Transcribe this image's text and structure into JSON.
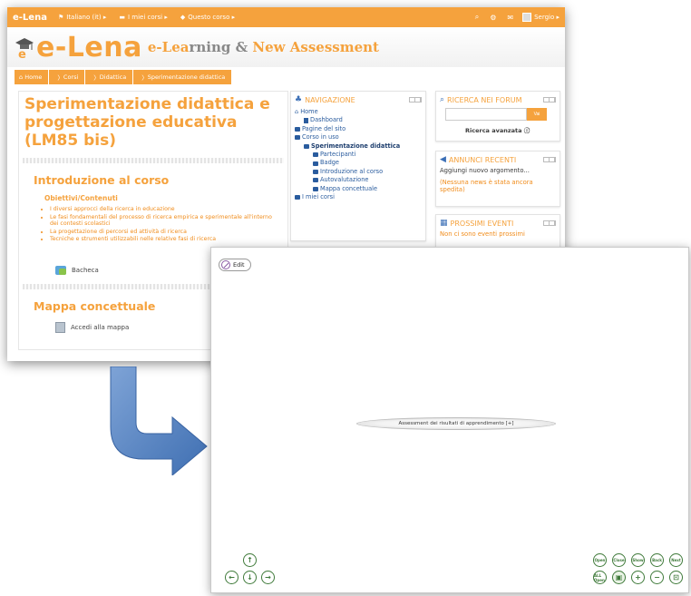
{
  "moodle": {
    "topbar": {
      "brand": "e-Lena",
      "menus": [
        "Italiano (it) ▸",
        "I miei corsi ▸",
        "Questo corso ▸"
      ],
      "user": "Sergio ▸"
    },
    "banner": {
      "logo_main": "e-Lena",
      "logo_sub_1": "e-Lea",
      "logo_sub_2": "rning & ",
      "logo_sub_3": "New Assessment"
    },
    "breadcrumbs": [
      "Home",
      "Corsi",
      "Didattica",
      "Sperimentazione didattica"
    ],
    "course_title": "Sperimentazione didattica e progettazione educativa (LM85 bis)",
    "sections": [
      {
        "title": "Introduzione al corso",
        "subheading": "Obiettivi/Contenuti",
        "bullets": [
          "I diversi approcci della ricerca in educazione",
          "Le fasi fondamentali del processo di ricerca empirica e sperimentale all'interno dei contesti scolastici",
          "La progettazione di percorsi ed attività di ricerca",
          "Tecniche e strumenti utilizzabili nelle relative fasi di ricerca"
        ],
        "activity": "Bacheca"
      },
      {
        "title": "Mappa concettuale",
        "activity": "Accedi alla mappa"
      }
    ],
    "navigation": {
      "title": "NAVIGAZIONE",
      "items": [
        "Home",
        "Dashboard",
        "Pagine del sito",
        "Corso in uso",
        "Sperimentazione didattica",
        "Partecipanti",
        "Badge",
        "Introduzione al corso",
        "Autovalutazione",
        "Mappa concettuale",
        "I miei corsi"
      ]
    },
    "search_block": {
      "title": "RICERCA NEI FORUM",
      "button": "Vai",
      "advanced": "Ricerca avanzata ⓘ"
    },
    "news_block": {
      "title": "ANNUNCI RECENTI",
      "add": "Aggiungi nuovo argomento...",
      "empty": "(Nessuna news è stata ancora spedita)"
    },
    "events_block": {
      "title": "PROSSIMI EVENTI",
      "empty": "Non ci sono eventi prossimi"
    }
  },
  "concept_map": {
    "edit_label": "Edit",
    "root_node": "Assessment dei risultati di apprendimento [+]",
    "toolbar_top": [
      "Open",
      "Close",
      "Show",
      "Back",
      "Next"
    ],
    "toolbar_bottom": [
      "ALL Open",
      "save",
      "zoom-in",
      "zoom-out",
      "fit"
    ],
    "pan_controls": [
      "up",
      "left",
      "down",
      "right"
    ]
  },
  "colors": {
    "accent": "#f5a23d",
    "link": "#2a5c9e",
    "control_green": "#3f7a3a",
    "arrow_blue": "#4f7fc0"
  }
}
